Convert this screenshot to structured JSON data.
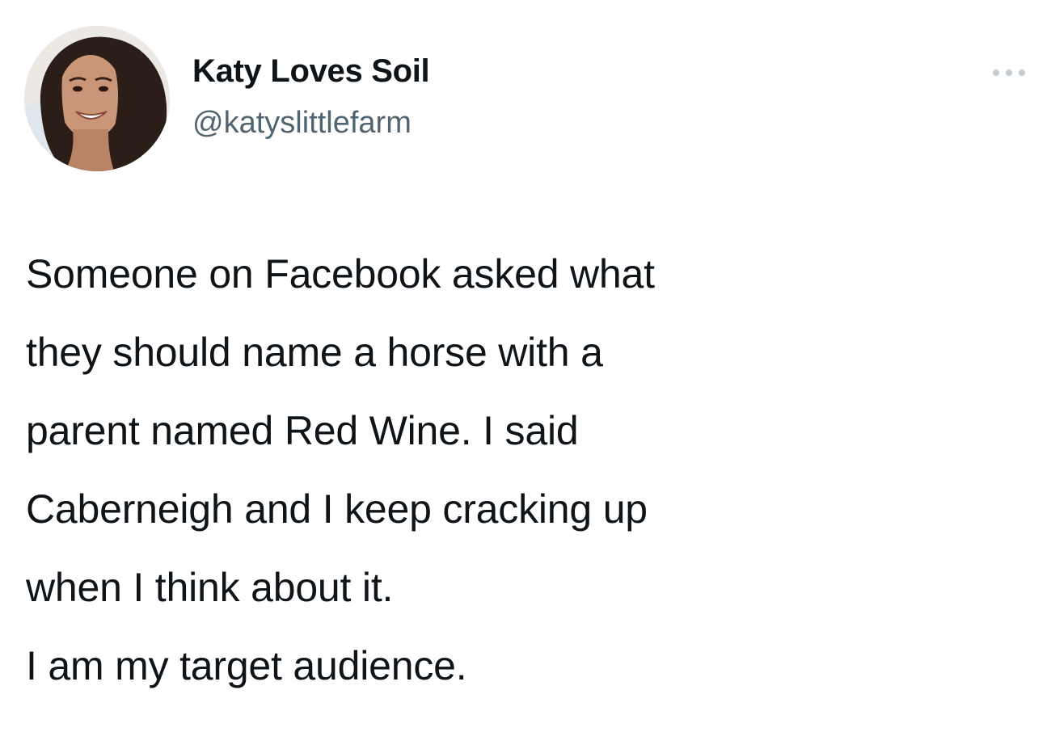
{
  "author": {
    "display_name": "Katy Loves Soil",
    "handle": "@katyslittlefarm",
    "avatar_icon": "profile-photo-avatar"
  },
  "tweet": {
    "lines": [
      "Someone on Facebook asked what",
      "they should name a horse with a",
      "parent named Red Wine. I said",
      "Caberneigh and I keep cracking up",
      "when I think about it.",
      "I am my target audience."
    ]
  },
  "menu": {
    "icon": "more-horizontal-icon"
  },
  "colors": {
    "text": "#0f1419",
    "secondary_text": "#536471",
    "background": "#ffffff",
    "more_icon": "#c4cbd1"
  }
}
